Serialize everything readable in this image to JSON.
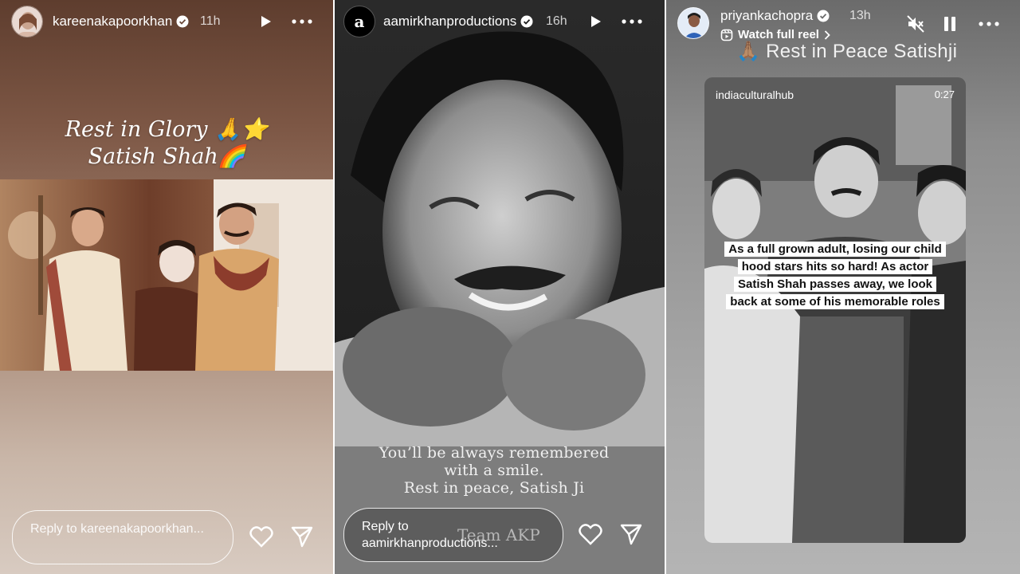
{
  "story1": {
    "username": "kareenakapoorkhan",
    "time": "11h",
    "caption_line1": "Rest in Glory 🙏⭐",
    "caption_line2": "Satish Shah🌈",
    "reply_placeholder": "Reply to kareenakapoorkhan..."
  },
  "story2": {
    "username": "aamirkhanproductions",
    "avatar_letter": "a",
    "time": "16h",
    "caption_line1": "You’ll be always remembered",
    "caption_line2": "with a smile.",
    "caption_line3": "Rest in peace, Satish Ji",
    "signature": "Team AKP",
    "reply_placeholder": "Reply to aamirkhanproductions..."
  },
  "story3": {
    "username": "priyankachopra",
    "time": "13h",
    "watch_label": "Watch full reel",
    "caption": "🙏🏽 Rest in Peace Satishji",
    "video_handle": "indiaculturalhub",
    "video_time": "0:27",
    "overlay_text": "As a full grown adult, losing our child hood stars hits so hard! As actor Satish Shah passes away, we look back at some of his memorable roles"
  },
  "icons": {
    "verified": "verified-badge-icon",
    "play": "play-icon",
    "pause": "pause-icon",
    "mute": "mute-icon",
    "more": "more-icon",
    "like": "heart-icon",
    "share": "send-icon",
    "reel": "reel-icon",
    "chevron": "chevron-right-icon"
  },
  "colors": {
    "verified": "#3897f0",
    "text": "#ffffff"
  }
}
